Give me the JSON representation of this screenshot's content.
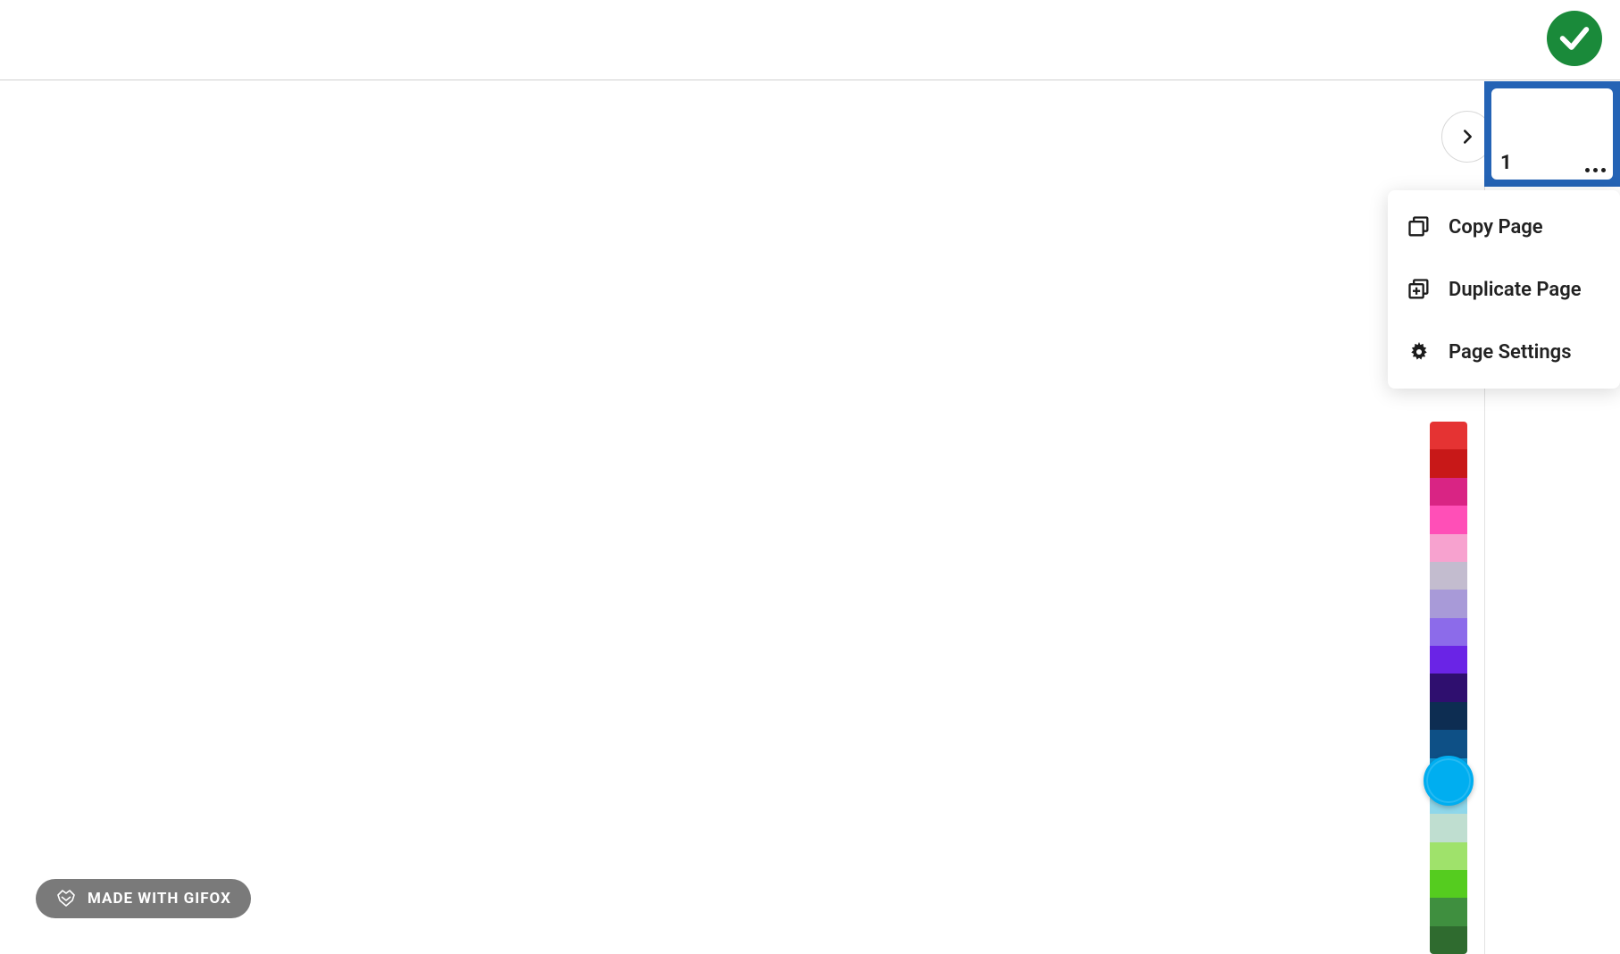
{
  "status": {
    "state": "success",
    "color": "#1a8a3a"
  },
  "page_thumb": {
    "number": "1",
    "selected": true,
    "selection_color": "#2463b5"
  },
  "context_menu": {
    "items": [
      {
        "icon": "copy-icon",
        "label": "Copy Page"
      },
      {
        "icon": "duplicate-icon",
        "label": "Duplicate Page"
      },
      {
        "icon": "gear-icon",
        "label": "Page Settings"
      }
    ]
  },
  "color_slider": {
    "segments": [
      "#e53333",
      "#c81818",
      "#d92484",
      "#ff4fb7",
      "#f7a2cf",
      "#c3bccf",
      "#a89ad8",
      "#8c6bea",
      "#6a24e6",
      "#2f0f6f",
      "#0d2d52",
      "#0e5086",
      "#0f97d4",
      "#8fd7ea",
      "#bfded0",
      "#9fe26b",
      "#55cc1f",
      "#3f8f3f",
      "#2f6b2f"
    ],
    "current_color": "#00aef0"
  },
  "watermark": {
    "text": "MADE WITH GIFOX"
  }
}
